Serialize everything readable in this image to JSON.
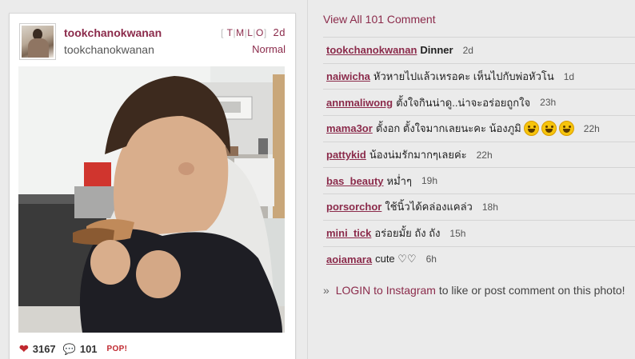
{
  "post": {
    "username": "tookchanokwanan",
    "fullname": "tookchanokwanan",
    "filter_links": [
      "T",
      "M",
      "L",
      "O"
    ],
    "age": "2d",
    "filter": "Normal",
    "likes": "3167",
    "comments_count": "101",
    "pop_label": "POP!"
  },
  "comments_panel": {
    "view_all": "View All 101 Comment",
    "comments": [
      {
        "user": "tookchanokwanan",
        "text": "Dinner",
        "time": "2d",
        "bold_text": true
      },
      {
        "user": "naiwicha",
        "text": "หัวหายไปแล้วเหรอคะ เห็นไปกับพ่อหัวโน",
        "time": "1d"
      },
      {
        "user": "annmaliwong",
        "text": "ตั้งใจกินน่าดู..น่าจะอร่อยถูกใจ",
        "time": "23h"
      },
      {
        "user": "mama3or",
        "text": "ตั้งอก ตั้งใจมากเลยนะคะ น้องภูมิ",
        "time": "22h",
        "emoji_count": 3
      },
      {
        "user": "pattykid",
        "text": "น้องน่มรักมากๆเลยค่ะ",
        "time": "22h"
      },
      {
        "user": "bas_beauty",
        "text": "หม่ำๆ",
        "time": "19h"
      },
      {
        "user": "porsorchor",
        "text": "ใช้นิ้วได้คล่องแคล่ว",
        "time": "18h"
      },
      {
        "user": "mini_tick",
        "text": "อร่อยมั้ย ถัง ถัง",
        "time": "15h"
      },
      {
        "user": "aoiamara",
        "text": "cute ♡♡",
        "time": "6h"
      }
    ],
    "login_prefix": "»",
    "login_link": "LOGIN to Instagram",
    "login_suffix": " to like or post comment on this photo!"
  },
  "colors": {
    "accent": "#8b2b4b",
    "heart": "#c0282f",
    "bubble": "#2a8aa6",
    "background": "#ebebeb"
  },
  "icons": {
    "likes": "heart-icon",
    "comments": "speech-bubble-icon",
    "emoji": "grinning-face-icon"
  }
}
